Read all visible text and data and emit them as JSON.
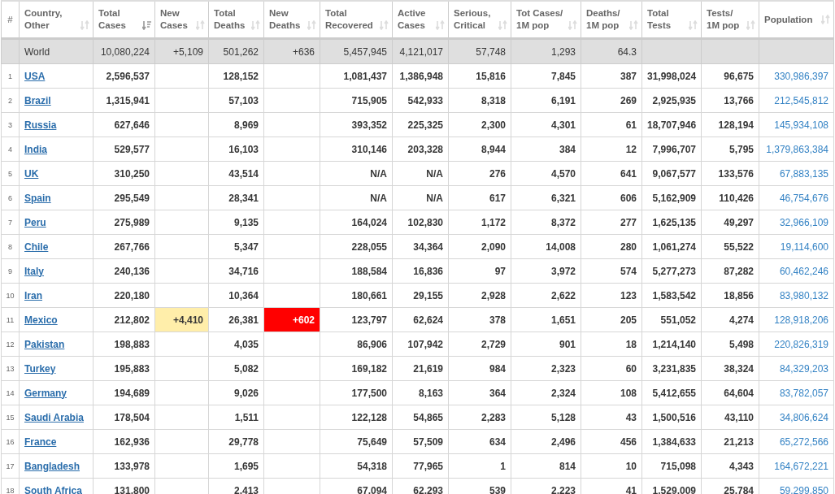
{
  "table": {
    "columns": [
      {
        "label": "#",
        "kind": "rank"
      },
      {
        "label": "Country, Other",
        "kind": "country",
        "sorted": false
      },
      {
        "label": "Total Cases",
        "kind": "number",
        "sorted": true
      },
      {
        "label": "New Cases",
        "kind": "new_cases",
        "sorted": false
      },
      {
        "label": "Total Deaths",
        "kind": "number",
        "sorted": false
      },
      {
        "label": "New Deaths",
        "kind": "new_deaths",
        "sorted": false
      },
      {
        "label": "Total Recovered",
        "kind": "number",
        "sorted": false
      },
      {
        "label": "Active Cases",
        "kind": "number",
        "sorted": false
      },
      {
        "label": "Serious, Critical",
        "kind": "number",
        "sorted": false
      },
      {
        "label": "Tot Cases/ 1M pop",
        "kind": "number",
        "sorted": false
      },
      {
        "label": "Deaths/ 1M pop",
        "kind": "number",
        "sorted": false
      },
      {
        "label": "Total Tests",
        "kind": "number",
        "sorted": false
      },
      {
        "label": "Tests/ 1M pop",
        "kind": "number",
        "sorted": false
      },
      {
        "label": "Population",
        "kind": "population",
        "sorted": false
      }
    ],
    "total_row": {
      "label": "World",
      "cells": [
        "10,080,224",
        "+5,109",
        "501,262",
        "+636",
        "5,457,945",
        "4,121,017",
        "57,748",
        "1,293",
        "64.3"
      ]
    },
    "rows": [
      [
        "1",
        "USA",
        "2,596,537",
        "",
        "128,152",
        "",
        "1,081,437",
        "1,386,948",
        "15,816",
        "7,845",
        "387",
        "31,998,024",
        "96,675",
        "330,986,397"
      ],
      [
        "2",
        "Brazil",
        "1,315,941",
        "",
        "57,103",
        "",
        "715,905",
        "542,933",
        "8,318",
        "6,191",
        "269",
        "2,925,935",
        "13,766",
        "212,545,812"
      ],
      [
        "3",
        "Russia",
        "627,646",
        "",
        "8,969",
        "",
        "393,352",
        "225,325",
        "2,300",
        "4,301",
        "61",
        "18,707,946",
        "128,194",
        "145,934,108"
      ],
      [
        "4",
        "India",
        "529,577",
        "",
        "16,103",
        "",
        "310,146",
        "203,328",
        "8,944",
        "384",
        "12",
        "7,996,707",
        "5,795",
        "1,379,863,384"
      ],
      [
        "5",
        "UK",
        "310,250",
        "",
        "43,514",
        "",
        "N/A",
        "N/A",
        "276",
        "4,570",
        "641",
        "9,067,577",
        "133,576",
        "67,883,135"
      ],
      [
        "6",
        "Spain",
        "295,549",
        "",
        "28,341",
        "",
        "N/A",
        "N/A",
        "617",
        "6,321",
        "606",
        "5,162,909",
        "110,426",
        "46,754,676"
      ],
      [
        "7",
        "Peru",
        "275,989",
        "",
        "9,135",
        "",
        "164,024",
        "102,830",
        "1,172",
        "8,372",
        "277",
        "1,625,135",
        "49,297",
        "32,966,109"
      ],
      [
        "8",
        "Chile",
        "267,766",
        "",
        "5,347",
        "",
        "228,055",
        "34,364",
        "2,090",
        "14,008",
        "280",
        "1,061,274",
        "55,522",
        "19,114,600"
      ],
      [
        "9",
        "Italy",
        "240,136",
        "",
        "34,716",
        "",
        "188,584",
        "16,836",
        "97",
        "3,972",
        "574",
        "5,277,273",
        "87,282",
        "60,462,246"
      ],
      [
        "10",
        "Iran",
        "220,180",
        "",
        "10,364",
        "",
        "180,661",
        "29,155",
        "2,928",
        "2,622",
        "123",
        "1,583,542",
        "18,856",
        "83,980,132"
      ],
      [
        "11",
        "Mexico",
        "212,802",
        "+4,410",
        "26,381",
        "+602",
        "123,797",
        "62,624",
        "378",
        "1,651",
        "205",
        "551,052",
        "4,274",
        "128,918,206"
      ],
      [
        "12",
        "Pakistan",
        "198,883",
        "",
        "4,035",
        "",
        "86,906",
        "107,942",
        "2,729",
        "901",
        "18",
        "1,214,140",
        "5,498",
        "220,826,319"
      ],
      [
        "13",
        "Turkey",
        "195,883",
        "",
        "5,082",
        "",
        "169,182",
        "21,619",
        "984",
        "2,323",
        "60",
        "3,231,835",
        "38,324",
        "84,329,203"
      ],
      [
        "14",
        "Germany",
        "194,689",
        "",
        "9,026",
        "",
        "177,500",
        "8,163",
        "364",
        "2,324",
        "108",
        "5,412,655",
        "64,604",
        "83,782,057"
      ],
      [
        "15",
        "Saudi Arabia",
        "178,504",
        "",
        "1,511",
        "",
        "122,128",
        "54,865",
        "2,283",
        "5,128",
        "43",
        "1,500,516",
        "43,110",
        "34,806,624"
      ],
      [
        "16",
        "France",
        "162,936",
        "",
        "29,778",
        "",
        "75,649",
        "57,509",
        "634",
        "2,496",
        "456",
        "1,384,633",
        "21,213",
        "65,272,566"
      ],
      [
        "17",
        "Bangladesh",
        "133,978",
        "",
        "1,695",
        "",
        "54,318",
        "77,965",
        "1",
        "814",
        "10",
        "715,098",
        "4,343",
        "164,672,221"
      ],
      [
        "18",
        "South Africa",
        "131,800",
        "",
        "2,413",
        "",
        "67,094",
        "62,293",
        "539",
        "2,223",
        "41",
        "1,529,009",
        "25,784",
        "59,299,850"
      ]
    ]
  }
}
